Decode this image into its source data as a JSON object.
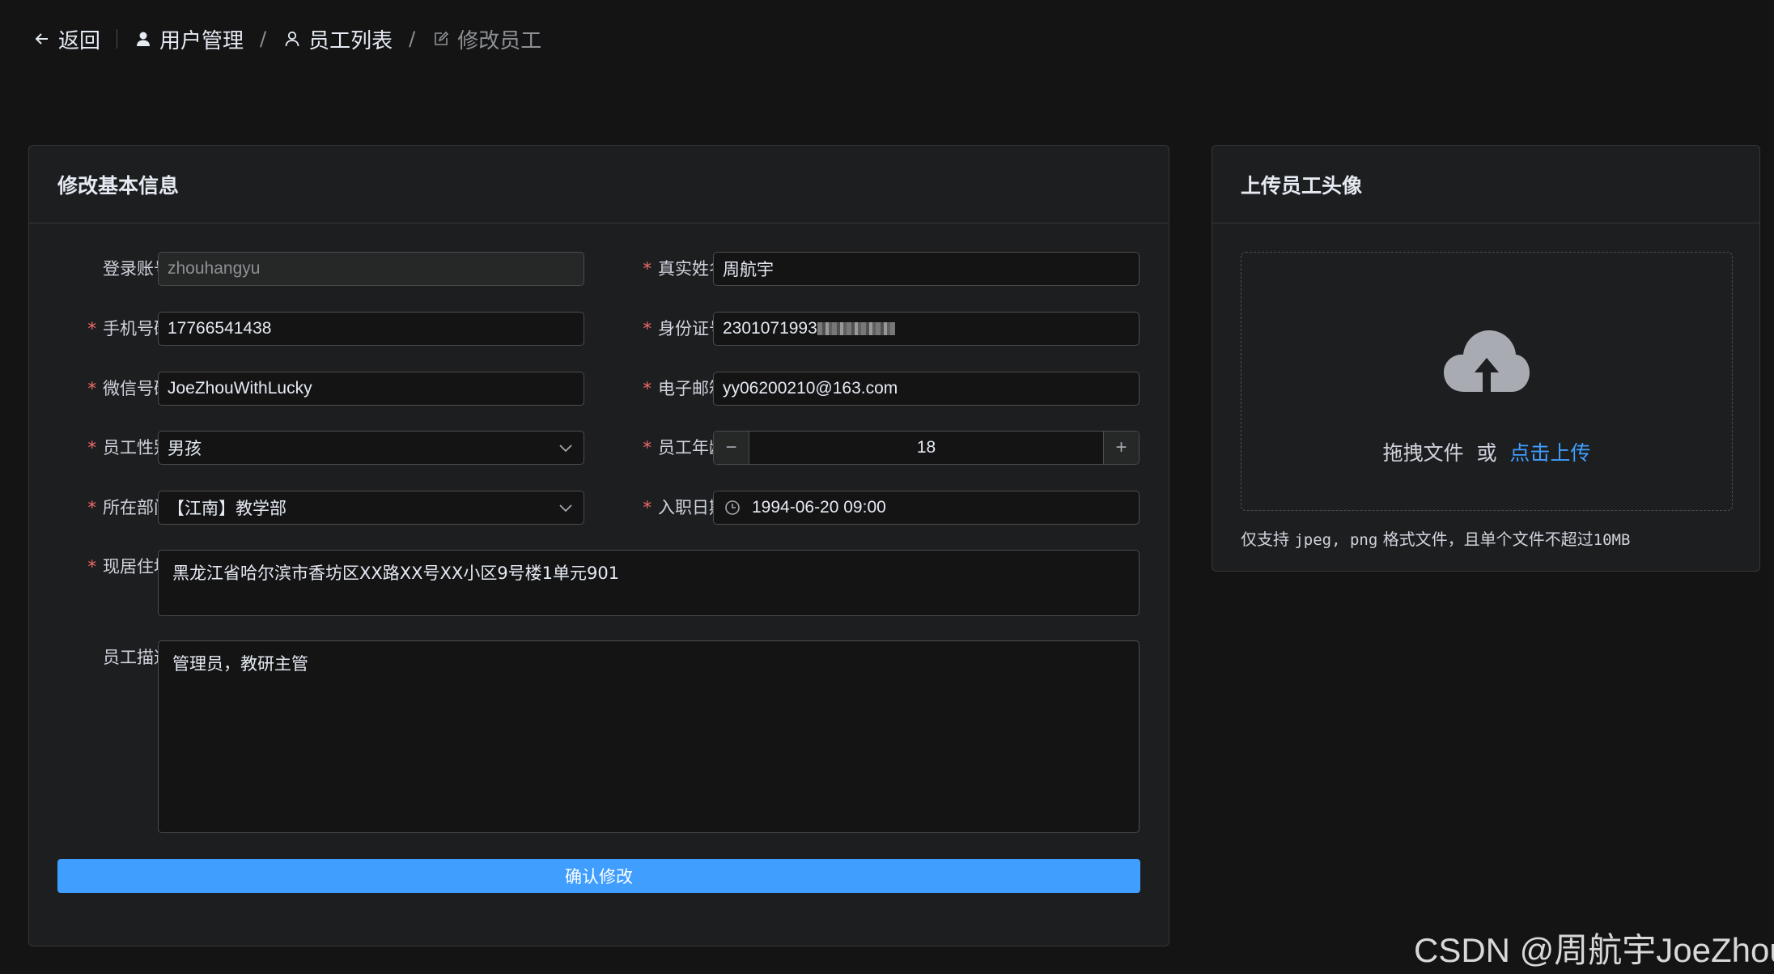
{
  "breadcrumb": {
    "back_label": "返回",
    "items": [
      "用户管理",
      "员工列表",
      "修改员工"
    ],
    "separator": "/"
  },
  "basic_info": {
    "title": "修改基本信息",
    "fields": {
      "login_account": {
        "label": "登录账号",
        "value": "zhouhangyu"
      },
      "real_name": {
        "label": "真实姓名",
        "value": "周航宇"
      },
      "phone": {
        "label": "手机号码",
        "value": "17766541438"
      },
      "id_card": {
        "label": "身份证号",
        "value": "2301071993"
      },
      "wechat": {
        "label": "微信号码",
        "value": "JoeZhouWithLucky"
      },
      "email": {
        "label": "电子邮箱",
        "value": "yy06200210@163.com"
      },
      "gender": {
        "label": "员工性别",
        "value": "男孩"
      },
      "age": {
        "label": "员工年龄",
        "value": "18",
        "minus": "−",
        "plus": "+"
      },
      "department": {
        "label": "所在部门",
        "value": "【江南】教学部"
      },
      "hire_date": {
        "label": "入职日期",
        "value": "1994-06-20 09:00"
      },
      "address": {
        "label": "现居住地",
        "value": "黑龙江省哈尔滨市香坊区XX路XX号XX小区9号楼1单元901"
      },
      "description": {
        "label": "员工描述",
        "value": "管理员，教研主管"
      }
    },
    "required_mark": "*",
    "submit_label": "确认修改"
  },
  "avatar_upload": {
    "title": "上传员工头像",
    "drag_text": "拖拽文件",
    "or_text": "或",
    "click_text": "点击上传",
    "tip_prefix": "仅支持",
    "tip_formats": "jpeg, png",
    "tip_suffix": "格式文件，且单个文件不超过",
    "tip_size": "10MB"
  },
  "watermark": "CSDN @周航宇JoeZhou",
  "colors": {
    "background": "#141414",
    "card": "#1d1e1f",
    "primary": "#409eff",
    "required": "#f56c6c",
    "border": "#4c4d4f"
  },
  "icons": [
    "arrow-left-icon",
    "user-filled-icon",
    "user-icon",
    "edit-icon",
    "chevron-down-icon",
    "clock-icon",
    "upload-cloud-icon"
  ]
}
